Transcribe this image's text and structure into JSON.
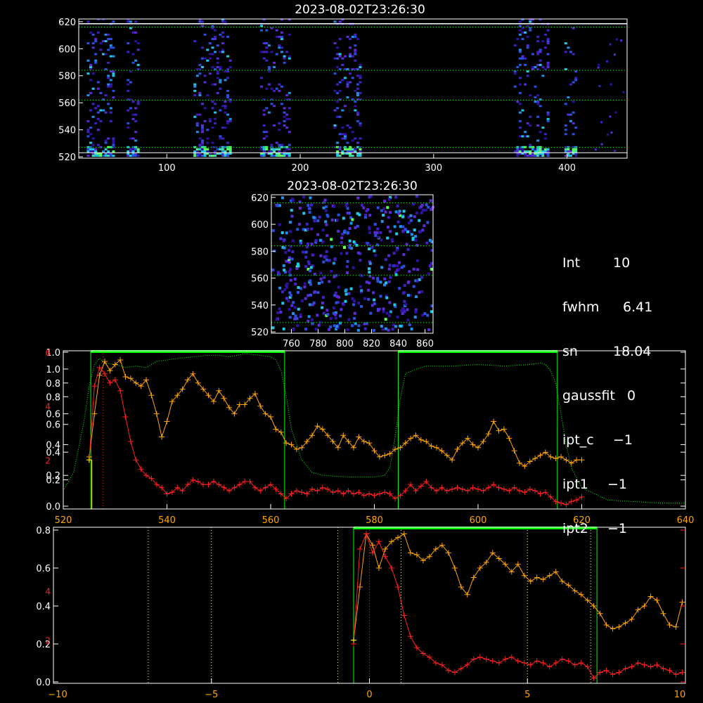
{
  "colors": {
    "axes": "#ffffff",
    "green_box": "#00ff00",
    "orange_series": "#ffa500",
    "red_series": "#ff2020",
    "green_dotted": "#00ff00",
    "yellow_marker": "#ffff00",
    "red_axis": "#ff2020"
  },
  "info_panel": [
    {
      "key": "Int",
      "value": "10"
    },
    {
      "key": "fwhm",
      "value": "6.41"
    },
    {
      "key": "sn",
      "value": "18.04"
    },
    {
      "key": "gaussfit",
      "value": "0"
    },
    {
      "key": "ipt_c",
      "value": "−1"
    },
    {
      "key": "ipt1",
      "value": "−1"
    },
    {
      "key": "ipt2",
      "value": "−1"
    }
  ],
  "chart_data": [
    {
      "type": "heatmap",
      "title": "2023-08-02T23:26:30",
      "xlim": [
        34,
        445
      ],
      "ylim": [
        519,
        622
      ],
      "x_ticks": [
        100,
        200,
        300,
        400
      ],
      "y_ticks": [
        520,
        540,
        560,
        580,
        600,
        620
      ],
      "row_lines": [
        616,
        584,
        562,
        527,
        523
      ],
      "active_columns": [
        [
          40,
          60
        ],
        [
          70,
          78
        ],
        [
          120,
          148
        ],
        [
          170,
          192
        ],
        [
          225,
          245
        ],
        [
          360,
          385
        ],
        [
          398,
          407
        ]
      ],
      "colormap": "blue-cyan-green"
    },
    {
      "type": "heatmap",
      "title": "2023-08-02T23:26:30",
      "xlim": [
        745,
        866
      ],
      "ylim": [
        519,
        622
      ],
      "x_ticks": [
        760,
        780,
        800,
        820,
        840,
        860
      ],
      "y_ticks": [
        520,
        540,
        560,
        580,
        600,
        620
      ],
      "row_lines": [
        616,
        584,
        562,
        527
      ]
    },
    {
      "type": "line",
      "xlim": [
        520,
        640
      ],
      "ylim": [
        0,
        1.0
      ],
      "x_ticks": [
        520,
        540,
        560,
        580,
        600,
        620,
        640
      ],
      "left_ticks": [
        "0.0",
        "0.2",
        "0.4",
        "0.6",
        "0.8",
        "1.0"
      ],
      "left_ticks_2": [
        "0.2",
        "0.4",
        "0.6",
        "0.8",
        "1.0"
      ],
      "red_ticks": [
        "2",
        "4",
        "6"
      ],
      "red_tick_values": [
        0.3,
        0.65,
        1.0
      ],
      "boxes": [
        [
          525.3,
          562.7
        ],
        [
          584.6,
          615.3
        ]
      ],
      "yellow_marker_x": 525.5,
      "red_marker_x": 527.7,
      "profile_curve": {
        "x": [
          520,
          522,
          524,
          525,
          526,
          527,
          528,
          530,
          532,
          534,
          536,
          538,
          540,
          542,
          545,
          548,
          550,
          552,
          555,
          558,
          560,
          561,
          562,
          563,
          564,
          566,
          568,
          570,
          575,
          580,
          582,
          583,
          584,
          585,
          586,
          588,
          590,
          595,
          600,
          605,
          610,
          612,
          613,
          614,
          615,
          616,
          617,
          618,
          620,
          625,
          630,
          635,
          640
        ],
        "y": [
          0.1,
          0.22,
          0.55,
          0.78,
          0.92,
          0.96,
          0.93,
          0.92,
          0.9,
          0.91,
          0.9,
          0.94,
          0.95,
          0.96,
          0.97,
          0.98,
          0.98,
          0.97,
          0.99,
          0.98,
          0.97,
          0.95,
          0.88,
          0.72,
          0.5,
          0.3,
          0.22,
          0.2,
          0.19,
          0.19,
          0.2,
          0.25,
          0.45,
          0.7,
          0.86,
          0.89,
          0.91,
          0.91,
          0.92,
          0.91,
          0.92,
          0.93,
          0.92,
          0.88,
          0.8,
          0.6,
          0.4,
          0.25,
          0.12,
          0.04,
          0.03,
          0.02,
          0.02
        ]
      },
      "series": [
        {
          "color": "orange",
          "x": [
            525,
            526,
            527,
            528,
            529,
            530,
            531,
            532,
            533,
            534,
            535,
            536,
            537,
            538,
            539,
            540,
            541,
            542,
            543,
            544,
            545,
            546,
            547,
            548,
            549,
            550,
            551,
            552,
            553,
            554,
            555,
            556,
            557,
            558,
            559,
            560,
            561,
            562,
            563,
            564,
            565,
            566,
            567,
            568,
            569,
            570,
            571,
            572,
            573,
            574,
            575,
            576,
            577,
            578,
            579,
            580,
            581,
            582,
            583,
            584,
            585,
            586,
            587,
            588,
            589,
            590,
            591,
            592,
            593,
            594,
            595,
            596,
            597,
            598,
            599,
            600,
            601,
            602,
            603,
            604,
            605,
            606,
            607,
            608,
            609,
            610,
            611,
            612,
            613,
            614,
            615,
            616,
            617,
            618,
            619,
            620
          ],
          "y": [
            0.32,
            0.6,
            0.85,
            0.94,
            0.88,
            0.92,
            0.95,
            0.84,
            0.83,
            0.8,
            0.78,
            0.82,
            0.72,
            0.6,
            0.45,
            0.55,
            0.68,
            0.72,
            0.76,
            0.82,
            0.86,
            0.8,
            0.76,
            0.72,
            0.68,
            0.75,
            0.7,
            0.64,
            0.6,
            0.66,
            0.66,
            0.7,
            0.73,
            0.65,
            0.6,
            0.58,
            0.5,
            0.48,
            0.41,
            0.4,
            0.37,
            0.38,
            0.42,
            0.46,
            0.52,
            0.5,
            0.46,
            0.42,
            0.38,
            0.46,
            0.42,
            0.38,
            0.45,
            0.42,
            0.41,
            0.36,
            0.32,
            0.33,
            0.34,
            0.37,
            0.38,
            0.41,
            0.44,
            0.46,
            0.43,
            0.42,
            0.39,
            0.38,
            0.36,
            0.33,
            0.3,
            0.37,
            0.41,
            0.44,
            0.4,
            0.38,
            0.42,
            0.47,
            0.55,
            0.49,
            0.5,
            0.44,
            0.36,
            0.28,
            0.26,
            0.29,
            0.31,
            0.33,
            0.35,
            0.32,
            0.31,
            0.32,
            0.3,
            0.28,
            0.3,
            0.3
          ]
        },
        {
          "color": "red",
          "x": [
            525,
            526,
            527,
            528,
            529,
            530,
            531,
            532,
            533,
            534,
            535,
            536,
            537,
            538,
            539,
            540,
            541,
            542,
            543,
            544,
            545,
            546,
            547,
            548,
            549,
            550,
            551,
            552,
            553,
            554,
            555,
            556,
            557,
            558,
            559,
            560,
            561,
            562,
            563,
            564,
            565,
            566,
            567,
            568,
            569,
            570,
            571,
            572,
            573,
            574,
            575,
            576,
            577,
            578,
            579,
            580,
            581,
            582,
            583,
            584,
            585,
            586,
            587,
            588,
            589,
            590,
            591,
            592,
            593,
            594,
            595,
            596,
            597,
            598,
            599,
            600,
            601,
            602,
            603,
            604,
            605,
            606,
            607,
            608,
            609,
            610,
            611,
            612,
            613,
            614,
            615,
            616,
            617,
            618,
            619,
            620
          ],
          "y": [
            0.3,
            0.78,
            0.9,
            0.86,
            0.8,
            0.82,
            0.75,
            0.58,
            0.42,
            0.3,
            0.24,
            0.2,
            0.18,
            0.14,
            0.12,
            0.08,
            0.09,
            0.12,
            0.1,
            0.14,
            0.17,
            0.16,
            0.14,
            0.14,
            0.16,
            0.14,
            0.12,
            0.1,
            0.12,
            0.14,
            0.16,
            0.16,
            0.12,
            0.1,
            0.12,
            0.14,
            0.11,
            0.08,
            0.05,
            0.08,
            0.1,
            0.09,
            0.08,
            0.11,
            0.1,
            0.12,
            0.11,
            0.09,
            0.1,
            0.08,
            0.1,
            0.08,
            0.09,
            0.07,
            0.08,
            0.07,
            0.08,
            0.09,
            0.08,
            0.05,
            0.07,
            0.1,
            0.14,
            0.1,
            0.13,
            0.16,
            0.12,
            0.1,
            0.12,
            0.1,
            0.11,
            0.12,
            0.11,
            0.1,
            0.12,
            0.11,
            0.1,
            0.12,
            0.14,
            0.12,
            0.11,
            0.1,
            0.12,
            0.1,
            0.09,
            0.11,
            0.1,
            0.08,
            0.09,
            0.06,
            0.03,
            0.02,
            0.01,
            0.03,
            0.04,
            0.06
          ]
        }
      ]
    },
    {
      "type": "line",
      "xlim": [
        -10,
        10
      ],
      "ylim": [
        0,
        0.8
      ],
      "x_ticks": [
        -10,
        -5,
        0,
        5,
        10
      ],
      "x_tick_labels": [
        "−10",
        "−5",
        "0",
        "5",
        "10"
      ],
      "left_ticks": [
        "0.0",
        "0.2",
        "0.4",
        "0.6",
        "0.8"
      ],
      "red_ticks": [
        "2",
        "4"
      ],
      "red_tick_values": [
        0.22,
        0.48
      ],
      "box": [
        -0.5,
        7.2
      ],
      "vertical_dotted_lines": [
        -7,
        -5,
        -1,
        1,
        5,
        7
      ],
      "yellow_marker_x": -0.5,
      "red_marker_x": 0,
      "series": [
        {
          "color": "orange",
          "x": [
            -0.5,
            -0.3,
            -0.1,
            0.1,
            0.3,
            0.5,
            0.7,
            0.9,
            1.1,
            1.3,
            1.5,
            1.7,
            1.9,
            2.1,
            2.3,
            2.5,
            2.7,
            2.9,
            3.1,
            3.3,
            3.5,
            3.7,
            3.9,
            4.1,
            4.3,
            4.5,
            4.7,
            4.9,
            5.1,
            5.3,
            5.5,
            5.7,
            5.9,
            6.1,
            6.3,
            6.5,
            6.7,
            6.9,
            7.1,
            7.3,
            7.5,
            7.7,
            7.9,
            8.1,
            8.3,
            8.5,
            8.7,
            8.9,
            9.1,
            9.3,
            9.5,
            9.7,
            9.9
          ],
          "y": [
            0.22,
            0.5,
            0.78,
            0.72,
            0.6,
            0.7,
            0.74,
            0.76,
            0.78,
            0.68,
            0.67,
            0.64,
            0.66,
            0.7,
            0.72,
            0.68,
            0.6,
            0.5,
            0.46,
            0.55,
            0.6,
            0.63,
            0.68,
            0.65,
            0.62,
            0.58,
            0.62,
            0.56,
            0.53,
            0.55,
            0.54,
            0.56,
            0.58,
            0.53,
            0.51,
            0.48,
            0.46,
            0.43,
            0.4,
            0.36,
            0.3,
            0.28,
            0.29,
            0.31,
            0.33,
            0.38,
            0.4,
            0.45,
            0.43,
            0.36,
            0.3,
            0.29,
            0.42
          ]
        },
        {
          "color": "red",
          "x": [
            -0.5,
            -0.3,
            -0.1,
            0.1,
            0.3,
            0.5,
            0.7,
            0.9,
            1.1,
            1.3,
            1.5,
            1.7,
            1.9,
            2.1,
            2.3,
            2.5,
            2.7,
            2.9,
            3.1,
            3.3,
            3.5,
            3.7,
            3.9,
            4.1,
            4.3,
            4.5,
            4.7,
            4.9,
            5.1,
            5.3,
            5.5,
            5.7,
            5.9,
            6.1,
            6.3,
            6.5,
            6.7,
            6.9,
            7.1,
            7.3,
            7.5,
            7.7,
            7.9,
            8.1,
            8.3,
            8.5,
            8.7,
            8.9,
            9.1,
            9.3,
            9.5,
            9.7,
            9.9
          ],
          "y": [
            0.2,
            0.7,
            0.78,
            0.68,
            0.74,
            0.66,
            0.6,
            0.5,
            0.35,
            0.24,
            0.18,
            0.15,
            0.13,
            0.1,
            0.09,
            0.06,
            0.05,
            0.07,
            0.09,
            0.12,
            0.13,
            0.12,
            0.11,
            0.1,
            0.12,
            0.13,
            0.11,
            0.1,
            0.09,
            0.11,
            0.1,
            0.08,
            0.1,
            0.12,
            0.11,
            0.09,
            0.1,
            0.08,
            0.02,
            0.05,
            0.06,
            0.04,
            0.05,
            0.07,
            0.08,
            0.1,
            0.09,
            0.08,
            0.09,
            0.07,
            0.06,
            0.04,
            0.05
          ]
        }
      ]
    }
  ]
}
